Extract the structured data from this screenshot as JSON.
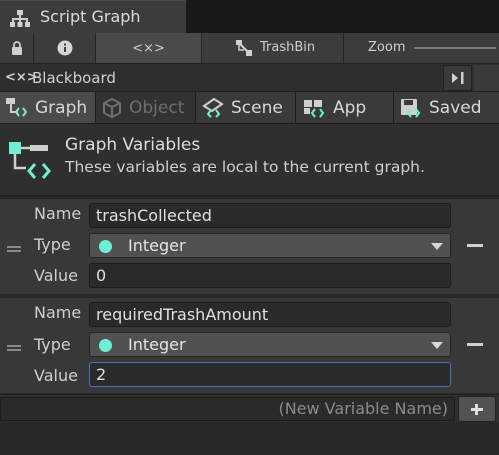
{
  "window": {
    "title": "Script Graph"
  },
  "toolbar": {
    "var_icon": "<×>",
    "graph_name": "TrashBin",
    "zoom_label": "Zoom"
  },
  "blackboard": {
    "icon": "<×>",
    "label": "Blackboard"
  },
  "scope_tabs": [
    {
      "label": "Graph",
      "state": "selected"
    },
    {
      "label": "Object",
      "state": "disabled"
    },
    {
      "label": "Scene",
      "state": "normal"
    },
    {
      "label": "App",
      "state": "normal"
    },
    {
      "label": "Saved",
      "state": "normal"
    }
  ],
  "graph_variables": {
    "title": "Graph Variables",
    "description": "These variables are local to the current graph."
  },
  "field_labels": {
    "name": "Name",
    "type": "Type",
    "value": "Value"
  },
  "variables": [
    {
      "name": "trashCollected",
      "type": "Integer",
      "value": "0"
    },
    {
      "name": "requiredTrashAmount",
      "type": "Integer",
      "value": "2"
    }
  ],
  "new_variable": {
    "placeholder": "(New Variable Name)"
  },
  "colors": {
    "integer_dot": "#6ef0d2",
    "variables_icon": "#6ef0d2",
    "focus_border": "#3a79bb"
  }
}
